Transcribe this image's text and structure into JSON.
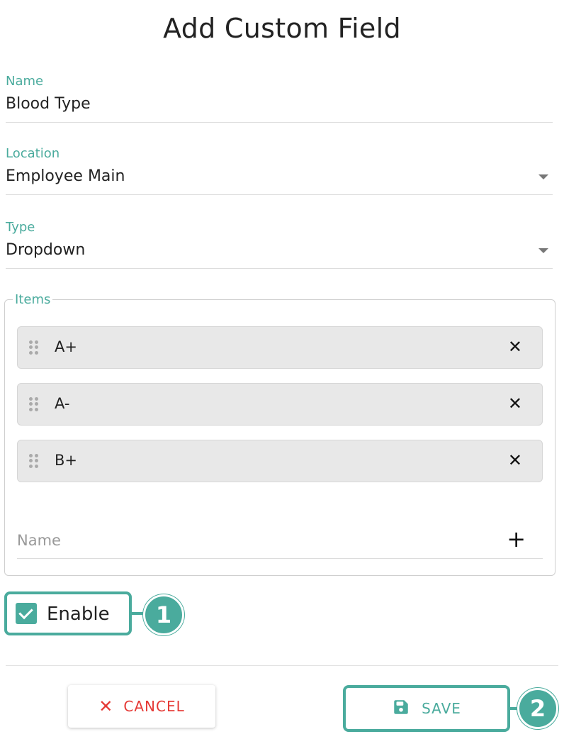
{
  "dialog": {
    "title": "Add Custom Field"
  },
  "fields": {
    "name": {
      "label": "Name",
      "value": "Blood Type"
    },
    "location": {
      "label": "Location",
      "value": "Employee Main"
    },
    "type": {
      "label": "Type",
      "value": "Dropdown"
    }
  },
  "items": {
    "legend": "Items",
    "list": [
      {
        "label": "A+",
        "remove_icon": "close-icon",
        "drag_icon": "drag-handle-icon"
      },
      {
        "label": "A-",
        "remove_icon": "close-icon",
        "drag_icon": "drag-handle-icon"
      },
      {
        "label": "B+",
        "remove_icon": "close-icon",
        "drag_icon": "drag-handle-icon"
      }
    ],
    "new_item_placeholder": "Name",
    "add_icon": "plus-icon"
  },
  "enable": {
    "label": "Enable",
    "checked": true
  },
  "callouts": {
    "one": "1",
    "two": "2"
  },
  "actions": {
    "cancel_label": "CANCEL",
    "save_label": "SAVE"
  },
  "colors": {
    "accent": "#4aab9d",
    "cancel": "#e53935"
  }
}
